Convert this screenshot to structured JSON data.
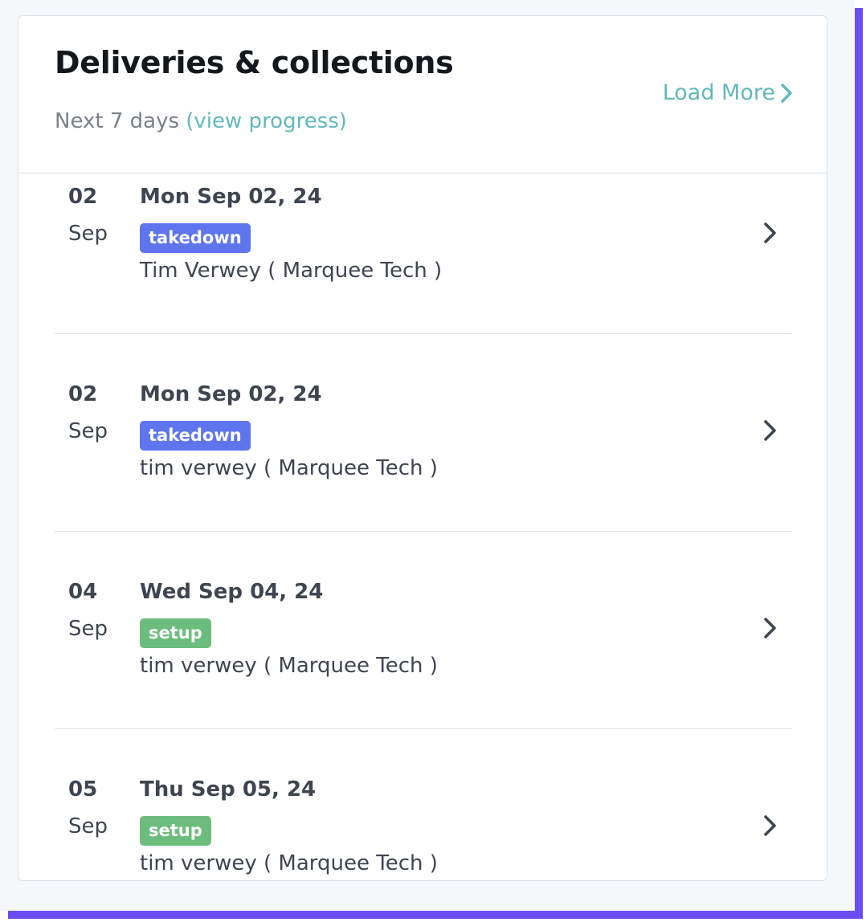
{
  "card": {
    "title": "Deliveries & collections",
    "subtitle_prefix": "Next 7 days",
    "subtitle_link": "(view progress)",
    "load_more": "Load More"
  },
  "colors": {
    "accent_link": "#62b8bd",
    "badge_takedown": "#5f75ee",
    "badge_setup": "#6cbd7d",
    "frame_shadow": "#6b4cf2"
  },
  "items": [
    {
      "day": "02",
      "month": "Sep",
      "date": "Mon Sep 02, 24",
      "badge": "takedown",
      "customer": "Tim Verwey ( Marquee Tech )",
      "icon": "chevron-right-icon"
    },
    {
      "day": "02",
      "month": "Sep",
      "date": "Mon Sep 02, 24",
      "badge": "takedown",
      "customer": "tim verwey ( Marquee Tech )",
      "icon": "chevron-right-icon"
    },
    {
      "day": "04",
      "month": "Sep",
      "date": "Wed Sep 04, 24",
      "badge": "setup",
      "customer": "tim verwey ( Marquee Tech )",
      "icon": "chevron-right-icon"
    },
    {
      "day": "05",
      "month": "Sep",
      "date": "Thu Sep 05, 24",
      "badge": "setup",
      "customer": "tim verwey ( Marquee Tech )",
      "icon": "chevron-right-icon"
    }
  ]
}
